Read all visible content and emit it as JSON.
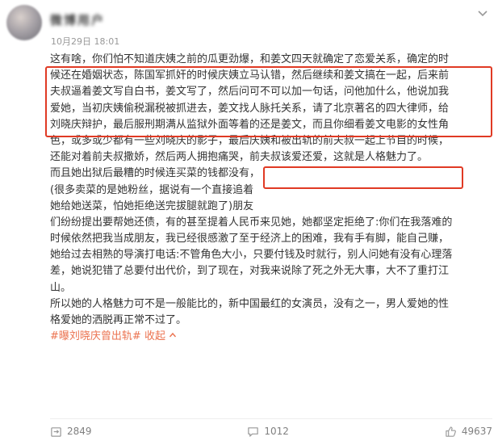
{
  "header": {
    "username": "微博用户",
    "timestamp": "10月29日 18:01",
    "menu_icon": "chevron-down-icon"
  },
  "post": {
    "lines": [
      "这有啥，你们怕不知道庆姨之前的瓜更劲爆，和姜文四天就确定了恋爱关系，确定的时",
      "候还在婚姻状态，陈国军抓奸的时候庆姨立马认错，然后继续和姜文搞在一起，后来前",
      "夫叔逼着姜文写自白书，姜文写了，然后问可不可以加一句话，问他加什么，他说加我",
      "爱她，当初庆姨偷税漏税被抓进去，姜文找人脉托关系，请了北京著名的四大律师，给",
      "刘晓庆辩护，最后服刑期满从监狱外面等着的还是姜文，而且你细看姜文电影的女性角",
      "色，或多或少都有一些刘晓庆的影子，最后庆姨和被出轨的前夫叔一起上节目的时候，",
      "还能对着前夫叔撒娇，然后两人拥抱痛哭，前夫叔该爱还爱，这就是人格魅力了。",
      "而且她出狱后最糟的时候连买菜的钱都没有，",
      "(很多卖菜的是她粉丝，据说有一个直接追着",
      "她给她送菜，怕她拒绝送完拔腿就跑了)朋友",
      "们纷纷提出要帮她还债，有的甚至提着人民币来见她，她都坚定拒绝了:你们在我落难的",
      "时候依然把我当成朋友，我已经很感激了至于经济上的困难，我有手有脚，能自己赚，",
      "她给过去相熟的导演打电话:不管角色大小，只要付钱及时就行，别人问她有没有心理落",
      "差，她说犯错了总要付出代价，到了现在，对我来说除了死之外无大事，大不了重打江",
      "山。",
      "所以她的人格魅力可不是一般能比的，新中国最红的女演员，没有之一，男人爱她的性",
      "格爱她的洒脱再正常不过了。"
    ],
    "topic": "#曝刘晓庆曾出轨#",
    "collapse_label": "收起",
    "collapse_icon": "chevron-up-icon",
    "highlight_color": "#e03a24",
    "link_color": "#eb7350"
  },
  "actions": {
    "repost_count": "2849",
    "comment_count": "1012",
    "like_count": "49637",
    "repost_icon": "repost-icon",
    "comment_icon": "comment-icon",
    "like_icon": "thumbs-up-icon"
  }
}
